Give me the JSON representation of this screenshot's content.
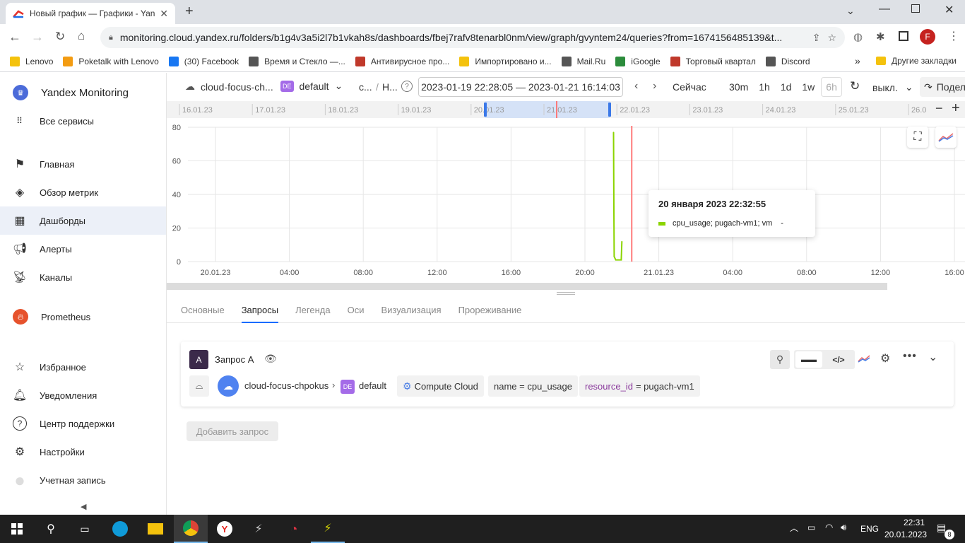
{
  "browser": {
    "tab_title": "Новый график — Графики - Yan",
    "url": "monitoring.cloud.yandex.ru/folders/b1g4v3a5i2l7b1vkah8s/dashboards/fbej7rafv8tenarbl0nm/view/graph/gvyntem24/queries?from=1674156485139&t...",
    "profile_initial": "F",
    "bookmarks": [
      {
        "label": "Lenovo",
        "color": "#f4c20d"
      },
      {
        "label": "Poketalk with Lenovo",
        "color": "#f39c12"
      },
      {
        "label": "(30) Facebook",
        "color": "#1877f2"
      },
      {
        "label": "Время и Стекло —...",
        "color": "#555555"
      },
      {
        "label": "Антивирусное про...",
        "color": "#c0392b"
      },
      {
        "label": "Импортировано и...",
        "color": "#f4c20d"
      },
      {
        "label": "Mail.Ru",
        "color": "#555555"
      },
      {
        "label": "iGoogle",
        "color": "#2c8c3c"
      },
      {
        "label": "Торговый квартал",
        "color": "#c0392b"
      },
      {
        "label": "Discord",
        "color": "#555555"
      }
    ],
    "bookmarks_more": "»",
    "other_bookmarks": "Другие закладки"
  },
  "sidebar": {
    "brand": "Yandex Monitoring",
    "all_services": "Все сервисы",
    "items": [
      {
        "label": "Главная",
        "icon": "flag-icon"
      },
      {
        "label": "Обзор метрик",
        "icon": "compass-icon"
      },
      {
        "label": "Дашборды",
        "icon": "grid-icon"
      },
      {
        "label": "Алерты",
        "icon": "megaphone-icon"
      },
      {
        "label": "Каналы",
        "icon": "satellite-icon"
      }
    ],
    "prometheus": "Prometheus",
    "bottom_items": [
      {
        "label": "Избранное",
        "icon": "star-icon"
      },
      {
        "label": "Уведомления",
        "icon": "bell-icon"
      },
      {
        "label": "Центр поддержки",
        "icon": "help-icon"
      },
      {
        "label": "Настройки",
        "icon": "gear-icon"
      },
      {
        "label": "Учетная запись",
        "icon": "avatar-icon"
      }
    ]
  },
  "controls": {
    "cloud": "cloud-focus-ch...",
    "folder_badge": "DE",
    "folder": "default",
    "crumb1": "с...",
    "crumb_sep": "/",
    "crumb2": "Н...",
    "time_range": "2023-01-19 22:28:05 — 2023-01-21 16:14:03",
    "now": "Сейчас",
    "ranges": [
      "30m",
      "1h",
      "1d",
      "1w",
      "6h"
    ],
    "refresh": "выкл.",
    "share": "Подели"
  },
  "timeline": {
    "labels": [
      "16.01.23",
      "17.01.23",
      "18.01.23",
      "19.01.23",
      "20.01.23",
      "21.01.23",
      "22.01.23",
      "23.01.23",
      "24.01.23",
      "25.01.23",
      "26.0"
    ]
  },
  "chart_data": {
    "type": "line",
    "series": [
      {
        "name": "cpu_usage; pugach-vm1; vm",
        "color": "#8bd400",
        "points": [
          {
            "x": "2023-01-20 21:33",
            "y": 77
          },
          {
            "x": "2023-01-20 21:34",
            "y": 30
          },
          {
            "x": "2023-01-20 21:35",
            "y": 3
          },
          {
            "x": "2023-01-20 21:40",
            "y": 1
          },
          {
            "x": "2023-01-20 21:58",
            "y": 1
          },
          {
            "x": "2023-01-20 22:00",
            "y": 12
          }
        ]
      }
    ],
    "xtick_labels": [
      "20.01.23",
      "04:00",
      "08:00",
      "12:00",
      "16:00",
      "20:00",
      "21.01.23",
      "04:00",
      "08:00",
      "12:00",
      "16:00"
    ],
    "ytick_labels": [
      "0",
      "20",
      "40",
      "60",
      "80"
    ],
    "ylim": [
      0,
      80
    ],
    "grid": true,
    "cursor_color": "#ff7a7a",
    "tooltip": {
      "title": "20 января 2023 22:32:55",
      "series": "cpu_usage; pugach-vm1; vm",
      "value": "-"
    }
  },
  "settings_tabs": [
    {
      "label": "Основные",
      "active": false
    },
    {
      "label": "Запросы",
      "active": true
    },
    {
      "label": "Легенда",
      "active": false
    },
    {
      "label": "Оси",
      "active": false
    },
    {
      "label": "Визуализация",
      "active": false
    },
    {
      "label": "Прореживание",
      "active": false
    }
  ],
  "query": {
    "badge": "A",
    "title": "Запрос A",
    "cloud": "cloud-focus-chpokus",
    "folder_badge": "DE",
    "folder": "default",
    "service": "Compute Cloud",
    "name_filter": "name = cpu_usage",
    "resource_key": "resource_id",
    "resource_value": "= pugach-vm1",
    "add_query": "Добавить запрос"
  },
  "taskbar": {
    "lang": "ENG",
    "time": "22:31",
    "date": "20.01.2023",
    "notifications": "8"
  }
}
